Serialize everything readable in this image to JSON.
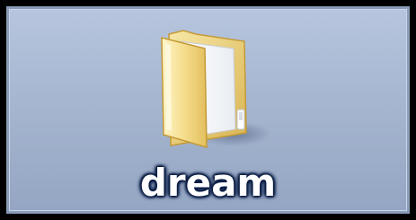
{
  "desktop_item": {
    "name": "dream",
    "icon": "folder-icon",
    "state": "selected",
    "colors": {
      "selection_background": "#a6b6d0",
      "selection_border": "#8b9db9",
      "folder_body": "#f1d77e",
      "label_text": "#ffffff",
      "label_glow": "#0b1f4a"
    }
  }
}
